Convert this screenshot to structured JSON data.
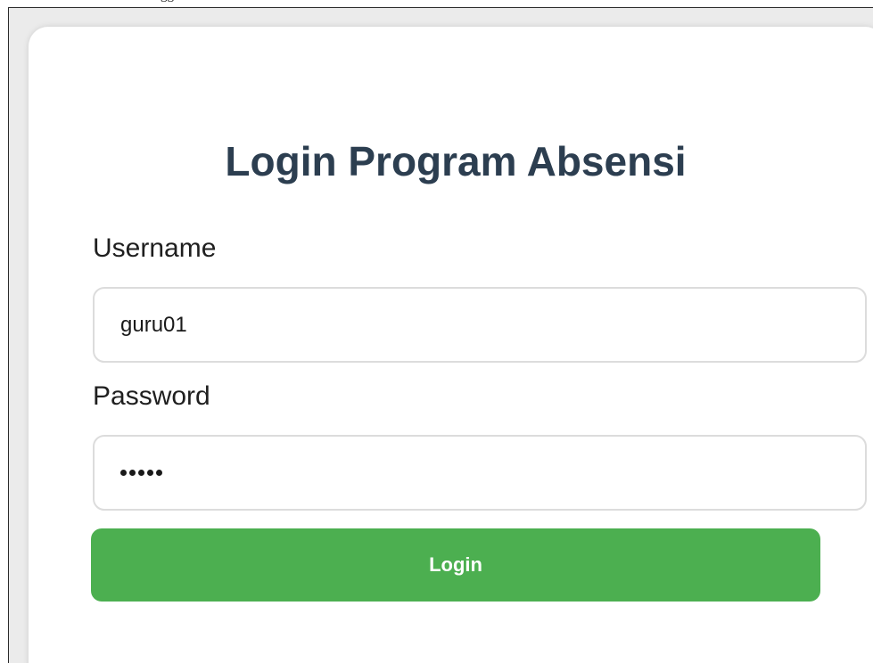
{
  "page": {
    "top_clipped_text": "ggi"
  },
  "login": {
    "title": "Login Program Absensi",
    "username_label": "Username",
    "username_value": "guru01",
    "password_label": "Password",
    "password_masked": "•••••",
    "button_label": "Login"
  },
  "colors": {
    "title": "#2c3e50",
    "button": "#4caf50",
    "field_border": "#dcdcdc"
  }
}
